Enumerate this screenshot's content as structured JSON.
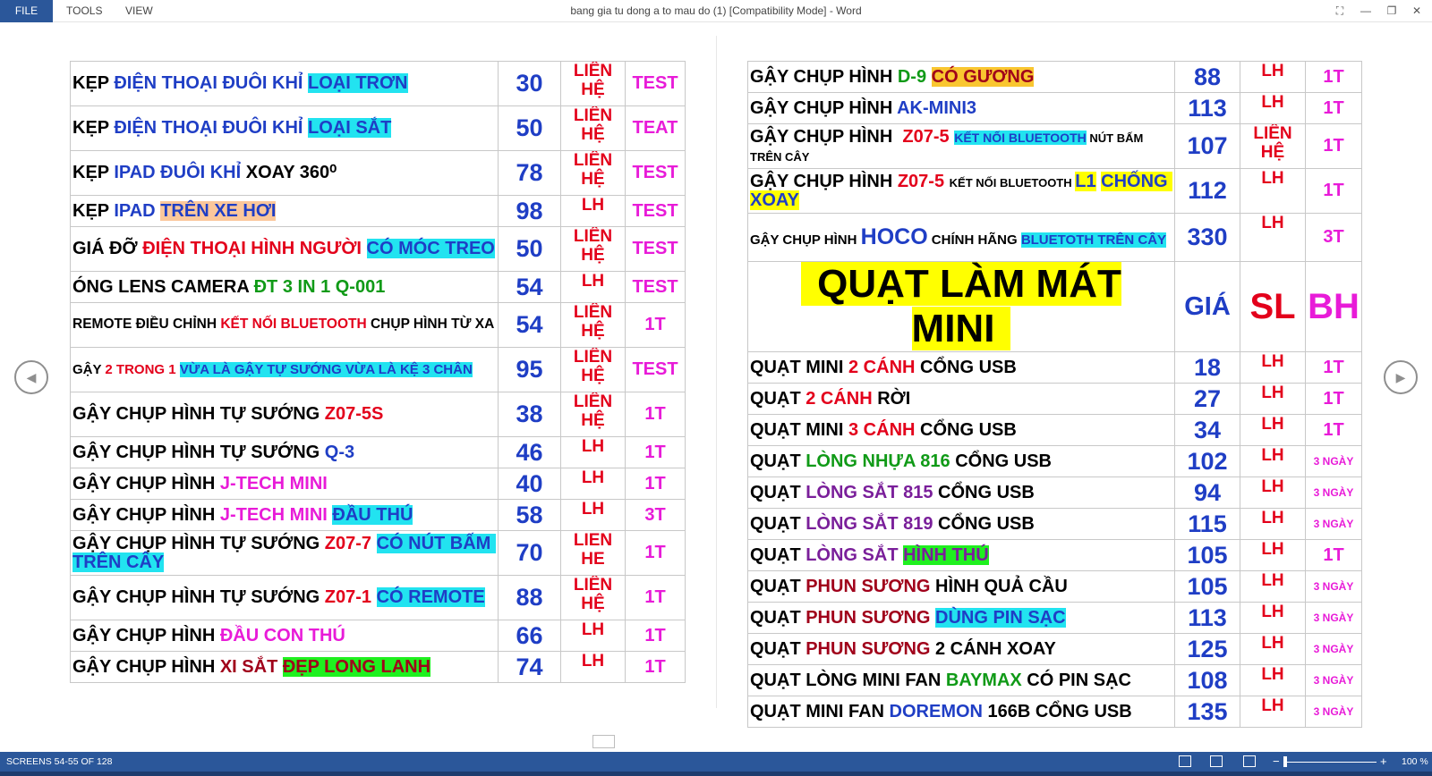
{
  "window": {
    "title": "bang gia tu dong a to mau do (1) [Compatibility Mode] - Word",
    "menu": [
      "FILE",
      "TOOLS",
      "VIEW"
    ]
  },
  "colors": {
    "ribbon_blue": "#2b579a",
    "price_blue": "#1f3ec5",
    "red": "#e3001b",
    "magenta": "#e81bd8"
  },
  "left_table": [
    {
      "name": [
        {
          "t": "KẸP ",
          "c": "#000"
        },
        {
          "t": "ĐIỆN THOẠI ĐUÔI KHỈ ",
          "c": "#1f3ec5"
        },
        {
          "t": "LOẠI TRƠN",
          "c": "#1f3ec5",
          "bg": "#22e3f0"
        }
      ],
      "price": "30",
      "lh": "LIÊN HỆ",
      "bh": "TEST"
    },
    {
      "name": [
        {
          "t": "KẸP ",
          "c": "#000"
        },
        {
          "t": "ĐIỆN THOẠI ĐUÔI KHỈ ",
          "c": "#1f3ec5"
        },
        {
          "t": "LOẠI SẮT",
          "c": "#1f3ec5",
          "bg": "#22e3f0"
        }
      ],
      "price": "50",
      "lh": "LIÊN HỆ",
      "bh": "TEAT"
    },
    {
      "name": [
        {
          "t": "KẸP ",
          "c": "#000"
        },
        {
          "t": "IPAD ĐUÔI KHỈ ",
          "c": "#1f3ec5"
        },
        {
          "t": "XOAY 360⁰",
          "c": "#000"
        }
      ],
      "price": "78",
      "lh": "LIÊN HỆ",
      "bh": "TEST"
    },
    {
      "name": [
        {
          "t": "KẸP ",
          "c": "#000"
        },
        {
          "t": "IPAD ",
          "c": "#1f3ec5"
        },
        {
          "t": "TRÊN XE HƠI",
          "c": "#1f3ec5",
          "bg": "#fbc79b"
        }
      ],
      "price": "98",
      "lh": "LH",
      "bh": "TEST"
    },
    {
      "name": [
        {
          "t": "GIÁ ĐỠ ",
          "c": "#000"
        },
        {
          "t": "ĐIỆN THOẠI HÌNH NGƯỜI ",
          "c": "#e3001b"
        },
        {
          "t": "CÓ MÓC TREO",
          "c": "#1f3ec5",
          "bg": "#22e3f0"
        }
      ],
      "price": "50",
      "lh": "LIÊN HỆ",
      "bh": "TEST"
    },
    {
      "name": [
        {
          "t": "ÓNG LENS CAMERA ",
          "c": "#000"
        },
        {
          "t": "ĐT 3 IN 1 Q-001",
          "c": "#109a17"
        }
      ],
      "price": "54",
      "lh": "LH",
      "bh": "TEST"
    },
    {
      "size": "sm",
      "name": [
        {
          "t": "REMOTE ĐIỀU CHỈNH ",
          "c": "#000"
        },
        {
          "t": "KẾT NỐI BLUETOOTH ",
          "c": "#e3001b"
        },
        {
          "t": "CHỤP HÌNH TỪ XA",
          "c": "#000"
        }
      ],
      "price": "54",
      "lh": "LIÊN HỆ",
      "bh": "1T"
    },
    {
      "size": "xs",
      "name": [
        {
          "t": "GẬY ",
          "c": "#000"
        },
        {
          "t": "2 TRONG 1 ",
          "c": "#e3001b"
        },
        {
          "t": "VỪA LÀ GẬY TỰ SƯỚNG VỪA LÀ KỆ 3 CHÂN",
          "c": "#1f3ec5",
          "bg": "#22e3f0"
        }
      ],
      "price": "95",
      "lh": "LIÊN HỆ",
      "bh": "TEST"
    },
    {
      "name": [
        {
          "t": "GẬY CHỤP HÌNH TỰ SƯỚNG ",
          "c": "#000"
        },
        {
          "t": "Z07-5S",
          "c": "#e3001b"
        }
      ],
      "price": "38",
      "lh": "LIÊN HỆ",
      "bh": "1T"
    },
    {
      "name": [
        {
          "t": "GẬY CHỤP HÌNH TỰ SƯỚNG ",
          "c": "#000"
        },
        {
          "t": "Q-3",
          "c": "#1f3ec5"
        }
      ],
      "price": "46",
      "lh": "LH",
      "bh": "1T"
    },
    {
      "name": [
        {
          "t": "GẬY CHỤP HÌNH ",
          "c": "#000"
        },
        {
          "t": "J-TECH MINI",
          "c": "#e81bd8"
        }
      ],
      "price": "40",
      "lh": "LH",
      "bh": "1T"
    },
    {
      "name": [
        {
          "t": "GẬY CHỤP HÌNH ",
          "c": "#000"
        },
        {
          "t": "J-TECH MINI ",
          "c": "#e81bd8"
        },
        {
          "t": "ĐẦU THÚ",
          "c": "#1f3ec5",
          "bg": "#22e3f0"
        }
      ],
      "price": "58",
      "lh": "LH",
      "bh": "3T"
    },
    {
      "name": [
        {
          "t": "GẬY CHỤP HÌNH TỰ SƯỚNG ",
          "c": "#000"
        },
        {
          "t": "Z07-7 ",
          "c": "#e3001b"
        },
        {
          "t": "CÓ NÚT BẤM TRÊN CÂY",
          "c": "#1f3ec5",
          "bg": "#22e3f0"
        }
      ],
      "price": "70",
      "lh": "LIEN HE",
      "bh": "1T"
    },
    {
      "name": [
        {
          "t": "GẬY CHỤP HÌNH TỰ SƯỚNG ",
          "c": "#000"
        },
        {
          "t": "Z07-1 ",
          "c": "#e3001b"
        },
        {
          "t": "CÓ REMOTE",
          "c": "#1f3ec5",
          "bg": "#22e3f0"
        }
      ],
      "price": "88",
      "lh": "LIÊN HỆ",
      "bh": "1T"
    },
    {
      "name": [
        {
          "t": "GẬY CHỤP HÌNH ",
          "c": "#000"
        },
        {
          "t": "ĐẦU CON THÚ",
          "c": "#e81bd8"
        }
      ],
      "price": "66",
      "lh": "LH",
      "bh": "1T"
    },
    {
      "name": [
        {
          "t": "GẬY CHỤP HÌNH ",
          "c": "#000"
        },
        {
          "t": "XI SẮT ",
          "c": "#a0001a"
        },
        {
          "t": "ĐẸP LONG LANH",
          "c": "#a0001a",
          "bg": "#1ff01f"
        }
      ],
      "price": "74",
      "lh": "LH",
      "bh": "1T"
    }
  ],
  "right_table_gay": [
    {
      "name": [
        {
          "t": "GẬY CHỤP HÌNH ",
          "c": "#000"
        },
        {
          "t": "D-9 ",
          "c": "#109a17"
        },
        {
          "t": "CÓ GƯƠNG",
          "c": "#a0001a",
          "bg": "#f9c630"
        }
      ],
      "price": "88",
      "lh": "LH",
      "bh": "1T"
    },
    {
      "name": [
        {
          "t": "GẬY CHỤP HÌNH ",
          "c": "#000"
        },
        {
          "t": "AK-MINI3",
          "c": "#1f3ec5"
        }
      ],
      "price": "113",
      "lh": "LH",
      "bh": "1T"
    },
    {
      "size": "mix",
      "name": [
        {
          "t": "GẬY CHỤP HÌNH  ",
          "c": "#000"
        },
        {
          "t": "Z07-5 ",
          "c": "#e3001b"
        },
        {
          "t": "KẾT NỐI BLUETOOTH",
          "c": "#1f3ec5",
          "bg": "#22e3f0",
          "s": "14px"
        },
        {
          "t": " NÚT BẤM TRÊN CÂY",
          "c": "#000",
          "s": "13px"
        }
      ],
      "price": "107",
      "lh": "LIÊN HỆ",
      "bh": "1T"
    },
    {
      "size": "mix",
      "name": [
        {
          "t": "GẬY CHỤP HÌNH ",
          "c": "#000"
        },
        {
          "t": "Z07-5 ",
          "c": "#e3001b"
        },
        {
          "t": "KẾT NỐI BLUETOOTH ",
          "c": "#000",
          "s": "13px"
        },
        {
          "t": "L1",
          "c": "#1f3ec5",
          "bg": "#ffff00"
        },
        {
          "t": " ",
          "c": "#000"
        },
        {
          "t": "CHỐNG XOAY",
          "c": "#1f3ec5",
          "bg": "#ffff00"
        }
      ],
      "price": "112",
      "lh": "LH",
      "bh": "1T"
    },
    {
      "size": "mix",
      "name": [
        {
          "t": "GẬY CHỤP HÌNH ",
          "c": "#000",
          "s": "15px"
        },
        {
          "t": "HOCO",
          "c": "#1f3ec5",
          "s": "25px"
        },
        {
          "t": " CHÍNH HÃNG ",
          "c": "#000",
          "s": "15px"
        },
        {
          "t": "BLUETOTH TRÊN CÂY",
          "c": "#1f3ec5",
          "bg": "#22e3f0",
          "s": "15px"
        }
      ],
      "price": "330",
      "lh": "LH",
      "bh": "3T"
    }
  ],
  "right_header": {
    "title": "QUẠT LÀM MÁT MINI",
    "price": "GIÁ",
    "lh": "SL",
    "bh": "BH"
  },
  "right_table_quat": [
    {
      "name": [
        {
          "t": "QUẠT MINI ",
          "c": "#000"
        },
        {
          "t": "2 CÁNH ",
          "c": "#e3001b"
        },
        {
          "t": "CỔNG USB",
          "c": "#000"
        }
      ],
      "price": "18",
      "lh": "LH",
      "bh": "1T"
    },
    {
      "name": [
        {
          "t": "QUẠT ",
          "c": "#000"
        },
        {
          "t": "2 CÁNH ",
          "c": "#e3001b"
        },
        {
          "t": "RỜI",
          "c": "#000"
        }
      ],
      "price": "27",
      "lh": "LH",
      "bh": "1T"
    },
    {
      "name": [
        {
          "t": "QUẠT MINI ",
          "c": "#000"
        },
        {
          "t": "3 CÁNH ",
          "c": "#e3001b"
        },
        {
          "t": "CỔNG USB",
          "c": "#000"
        }
      ],
      "price": "34",
      "lh": "LH",
      "bh": "1T"
    },
    {
      "name": [
        {
          "t": "QUẠT ",
          "c": "#000"
        },
        {
          "t": "LÒNG NHỰA 816 ",
          "c": "#109a17"
        },
        {
          "t": "CỔNG USB",
          "c": "#000"
        }
      ],
      "price": "102",
      "lh": "LH",
      "bh": "3 NGÀY",
      "bhs": true
    },
    {
      "name": [
        {
          "t": "QUẠT ",
          "c": "#000"
        },
        {
          "t": "LÒNG SẮT 815 ",
          "c": "#7a1f9a"
        },
        {
          "t": "CỔNG USB",
          "c": "#000"
        }
      ],
      "price": "94",
      "lh": "LH",
      "bh": "3 NGÀY",
      "bhs": true
    },
    {
      "name": [
        {
          "t": "QUẠT ",
          "c": "#000"
        },
        {
          "t": "LÒNG SẮT 819 ",
          "c": "#7a1f9a"
        },
        {
          "t": "CỔNG USB",
          "c": "#000"
        }
      ],
      "price": "115",
      "lh": "LH",
      "bh": "3 NGÀY",
      "bhs": true
    },
    {
      "name": [
        {
          "t": "QUẠT ",
          "c": "#000"
        },
        {
          "t": "LÒNG SẮT ",
          "c": "#7a1f9a"
        },
        {
          "t": "HÌNH THÚ",
          "c": "#7a1f9a",
          "bg": "#1ff01f"
        }
      ],
      "price": "105",
      "lh": "LH",
      "bh": "1T"
    },
    {
      "name": [
        {
          "t": "QUẠT ",
          "c": "#000"
        },
        {
          "t": "PHUN SƯƠNG ",
          "c": "#a0001a"
        },
        {
          "t": "HÌNH QUẢ CẦU",
          "c": "#000"
        }
      ],
      "price": "105",
      "lh": "LH",
      "bh": "3 NGÀY",
      "bhs": true
    },
    {
      "name": [
        {
          "t": "QUẠT ",
          "c": "#000"
        },
        {
          "t": "PHUN SƯƠNG ",
          "c": "#a0001a"
        },
        {
          "t": "DÙNG PIN SẠC",
          "c": "#1f3ec5",
          "bg": "#22e3f0"
        }
      ],
      "price": "113",
      "lh": "LH",
      "bh": "3 NGÀY",
      "bhs": true
    },
    {
      "name": [
        {
          "t": "QUẠT ",
          "c": "#000"
        },
        {
          "t": "PHUN SƯƠNG ",
          "c": "#a0001a"
        },
        {
          "t": "2 CÁNH XOAY",
          "c": "#000"
        }
      ],
      "price": "125",
      "lh": "LH",
      "bh": "3 NGÀY",
      "bhs": true
    },
    {
      "name": [
        {
          "t": "QUẠT LÒNG MINI FAN ",
          "c": "#000"
        },
        {
          "t": "BAYMAX ",
          "c": "#109a17"
        },
        {
          "t": "CÓ PIN SẠC",
          "c": "#000"
        }
      ],
      "price": "108",
      "lh": "LH",
      "bh": "3 NGÀY",
      "bhs": true
    },
    {
      "name": [
        {
          "t": "QUẠT MINI FAN ",
          "c": "#000"
        },
        {
          "t": "DOREMON ",
          "c": "#1f3ec5"
        },
        {
          "t": "166B CỔNG USB",
          "c": "#000"
        }
      ],
      "price": "135",
      "lh": "LH",
      "bh": "3 NGÀY",
      "bhs": true
    }
  ],
  "status": {
    "screens": "SCREENS 54-55 OF 128",
    "zoom_minus": "−",
    "zoom_plus": "+",
    "zoom_level": "100 %"
  },
  "icons": [
    "full-screen-icon",
    "minimize-icon",
    "restore-icon",
    "close-icon",
    "previous-page-icon",
    "next-page-icon",
    "read-mode-icon",
    "print-layout-icon",
    "web-layout-icon"
  ]
}
